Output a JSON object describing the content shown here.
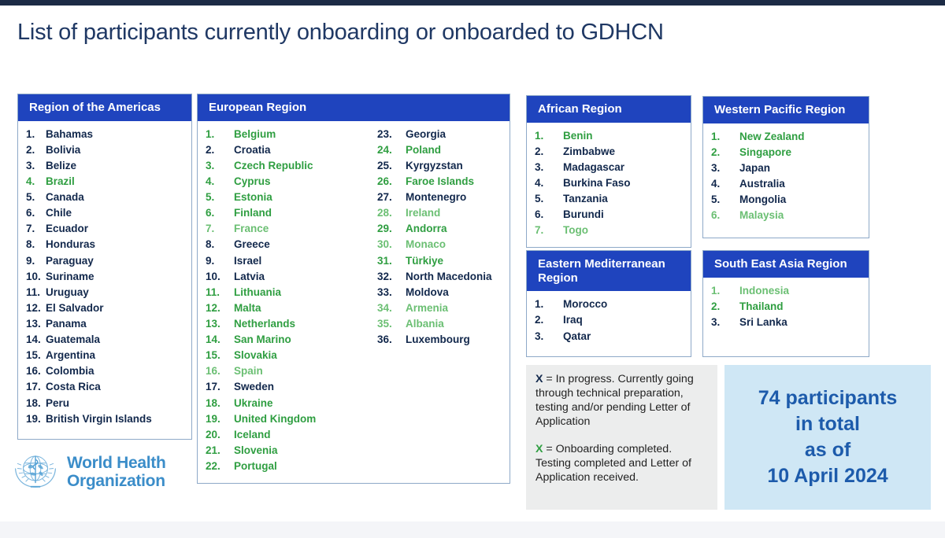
{
  "title": "List of participants currently onboarding or onboarded to GDHCN",
  "colors": {
    "header_blue": "#1F44BE",
    "navy_text": "#12284C",
    "green_completed": "#2F9E41",
    "green_light": "#6BBF73",
    "total_box_bg": "#CFE7F5",
    "total_text": "#1D5BAB",
    "legend_bg": "#ECEDED",
    "who_logo_blue": "#3B8DC9"
  },
  "regions": {
    "americas": {
      "title": "Region of the Americas",
      "items": [
        {
          "n": "1.",
          "name": "Bahamas",
          "status": "navy"
        },
        {
          "n": "2.",
          "name": "Bolivia",
          "status": "navy"
        },
        {
          "n": "3.",
          "name": "Belize",
          "status": "navy"
        },
        {
          "n": "4.",
          "name": "Brazil",
          "status": "green"
        },
        {
          "n": "5.",
          "name": "Canada",
          "status": "navy"
        },
        {
          "n": "6.",
          "name": "Chile",
          "status": "navy"
        },
        {
          "n": "7.",
          "name": "Ecuador",
          "status": "navy"
        },
        {
          "n": "8.",
          "name": "Honduras",
          "status": "navy"
        },
        {
          "n": "9.",
          "name": "Paraguay",
          "status": "navy"
        },
        {
          "n": "10.",
          "name": "Suriname",
          "status": "navy"
        },
        {
          "n": "11.",
          "name": "Uruguay",
          "status": "navy"
        },
        {
          "n": "12.",
          "name": "El Salvador",
          "status": "navy"
        },
        {
          "n": "13.",
          "name": "Panama",
          "status": "navy"
        },
        {
          "n": "14.",
          "name": "Guatemala",
          "status": "navy"
        },
        {
          "n": "15.",
          "name": "Argentina",
          "status": "navy"
        },
        {
          "n": "16.",
          "name": "Colombia",
          "status": "navy"
        },
        {
          "n": "17.",
          "name": "Costa Rica",
          "status": "navy"
        },
        {
          "n": "18.",
          "name": "Peru",
          "status": "navy"
        },
        {
          "n": "19.",
          "name": "British Virgin Islands",
          "status": "navy"
        }
      ]
    },
    "europe": {
      "title": "European Region",
      "column_a": [
        {
          "n": "1.",
          "name": "Belgium",
          "status": "green"
        },
        {
          "n": "2.",
          "name": "Croatia",
          "status": "navy"
        },
        {
          "n": "3.",
          "name": "Czech Republic",
          "status": "green"
        },
        {
          "n": "4.",
          "name": "Cyprus",
          "status": "green"
        },
        {
          "n": "5.",
          "name": "Estonia",
          "status": "green"
        },
        {
          "n": "6.",
          "name": "Finland",
          "status": "green"
        },
        {
          "n": "7.",
          "name": "France",
          "status": "greenlite"
        },
        {
          "n": "8.",
          "name": "Greece",
          "status": "navy"
        },
        {
          "n": "9.",
          "name": "Israel",
          "status": "navy"
        },
        {
          "n": "10.",
          "name": "Latvia",
          "status": "navy"
        },
        {
          "n": "11.",
          "name": "Lithuania",
          "status": "green"
        },
        {
          "n": "12.",
          "name": "Malta",
          "status": "green"
        },
        {
          "n": "13.",
          "name": "Netherlands",
          "status": "green"
        },
        {
          "n": "14.",
          "name": "San Marino",
          "status": "green"
        },
        {
          "n": "15.",
          "name": "Slovakia",
          "status": "green"
        },
        {
          "n": "16.",
          "name": "Spain",
          "status": "greenlite"
        },
        {
          "n": "17.",
          "name": "Sweden",
          "status": "navy"
        },
        {
          "n": "18.",
          "name": "Ukraine",
          "status": "green"
        },
        {
          "n": "19.",
          "name": "United Kingdom",
          "status": "green"
        },
        {
          "n": "20.",
          "name": "Iceland",
          "status": "green"
        },
        {
          "n": "21.",
          "name": "Slovenia",
          "status": "green"
        },
        {
          "n": "22.",
          "name": "Portugal",
          "status": "green"
        }
      ],
      "column_b": [
        {
          "n": "23.",
          "name": "Georgia",
          "status": "navy"
        },
        {
          "n": "24.",
          "name": "Poland",
          "status": "green"
        },
        {
          "n": "25.",
          "name": "Kyrgyzstan",
          "status": "navy"
        },
        {
          "n": "26.",
          "name": "Faroe Islands",
          "status": "green"
        },
        {
          "n": "27.",
          "name": "Montenegro",
          "status": "navy"
        },
        {
          "n": "28.",
          "name": "Ireland",
          "status": "greenlite"
        },
        {
          "n": "29.",
          "name": "Andorra",
          "status": "green"
        },
        {
          "n": "30.",
          "name": "Monaco",
          "status": "greenlite"
        },
        {
          "n": "31.",
          "name": "Türkiye",
          "status": "green"
        },
        {
          "n": "32.",
          "name": "North Macedonia",
          "status": "navy"
        },
        {
          "n": "33.",
          "name": "Moldova",
          "status": "navy"
        },
        {
          "n": "34.",
          "name": "Armenia",
          "status": "greenlite"
        },
        {
          "n": "35.",
          "name": "Albania",
          "status": "greenlite"
        },
        {
          "n": "36.",
          "name": "Luxembourg",
          "status": "navy"
        }
      ]
    },
    "africa": {
      "title": "African Region",
      "items": [
        {
          "n": "1.",
          "name": "Benin",
          "status": "green"
        },
        {
          "n": "2.",
          "name": "Zimbabwe",
          "status": "navy"
        },
        {
          "n": "3.",
          "name": "Madagascar",
          "status": "navy"
        },
        {
          "n": "4.",
          "name": "Burkina Faso",
          "status": "navy"
        },
        {
          "n": "5.",
          "name": "Tanzania",
          "status": "navy"
        },
        {
          "n": "6.",
          "name": "Burundi",
          "status": "navy"
        },
        {
          "n": "7.",
          "name": "Togo",
          "status": "greenlite"
        }
      ]
    },
    "western_pacific": {
      "title": "Western Pacific Region",
      "items": [
        {
          "n": "1.",
          "name": "New Zealand",
          "status": "green"
        },
        {
          "n": "2.",
          "name": "Singapore",
          "status": "green"
        },
        {
          "n": "3.",
          "name": "Japan",
          "status": "navy"
        },
        {
          "n": "4.",
          "name": "Australia",
          "status": "navy"
        },
        {
          "n": "5.",
          "name": "Mongolia",
          "status": "navy"
        },
        {
          "n": "6.",
          "name": "Malaysia",
          "status": "greenlite"
        }
      ]
    },
    "eastern_mediterranean": {
      "title": "Eastern Mediterranean Region",
      "items": [
        {
          "n": "1.",
          "name": "Morocco",
          "status": "navy"
        },
        {
          "n": "2.",
          "name": "Iraq",
          "status": "navy"
        },
        {
          "n": "3.",
          "name": "Qatar",
          "status": "navy"
        }
      ]
    },
    "south_east_asia": {
      "title": "South East Asia Region",
      "items": [
        {
          "n": "1.",
          "name": "Indonesia",
          "status": "greenlite"
        },
        {
          "n": "2.",
          "name": "Thailand",
          "status": "green"
        },
        {
          "n": "3.",
          "name": "Sri Lanka",
          "status": "navy"
        }
      ]
    }
  },
  "legend": {
    "key": "X",
    "in_progress_text": "= In progress. Currently going through technical preparation, testing and/or pending Letter of Application",
    "completed_text": "= Onboarding completed. Testing completed and Letter of Application received."
  },
  "total": {
    "line1": "74 participants",
    "line2": "in total",
    "line3": "as of",
    "line4": "10 April 2024"
  },
  "logo": {
    "line1": "World Health",
    "line2": "Organization"
  }
}
